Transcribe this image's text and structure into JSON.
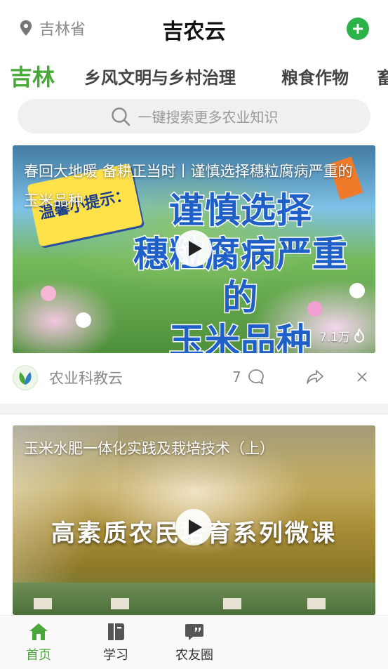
{
  "header": {
    "location": "吉林省",
    "title": "吉农云",
    "location_icon": "location-pin-icon",
    "add_icon": "plus-circle-icon",
    "accent_color": "#2bb34a"
  },
  "tabs": [
    {
      "label": "吉林",
      "active": true
    },
    {
      "label": "乡风文明与乡村治理",
      "active": false
    },
    {
      "label": "粮食作物",
      "active": false
    },
    {
      "label": "畜",
      "active": false
    }
  ],
  "search": {
    "placeholder": "一键搜索更多农业知识",
    "icon": "search-icon"
  },
  "feed": [
    {
      "title": "春回大地暖 备耕正当时丨谨慎选择穗粒腐病严重的玉米品种",
      "poster_badge": "温馨小提示：",
      "poster_lines": [
        "谨慎选择",
        "穗粒腐病严重的",
        "玉米品种"
      ],
      "views": "7.1万",
      "views_icon": "flame-icon",
      "source": "农业科教云",
      "comments": "7",
      "comment_icon": "comment-icon",
      "share_icon": "share-icon",
      "close_icon": "close-icon"
    },
    {
      "title": "玉米水肥一体化实践及栽培技术（上）",
      "poster_text": "高素质农民培育系列微课"
    }
  ],
  "bottom_nav": [
    {
      "label": "首页",
      "icon": "home-icon",
      "active": true
    },
    {
      "label": "学习",
      "icon": "book-icon",
      "active": false
    },
    {
      "label": "农友圈",
      "icon": "chat-quote-icon",
      "active": false
    }
  ]
}
